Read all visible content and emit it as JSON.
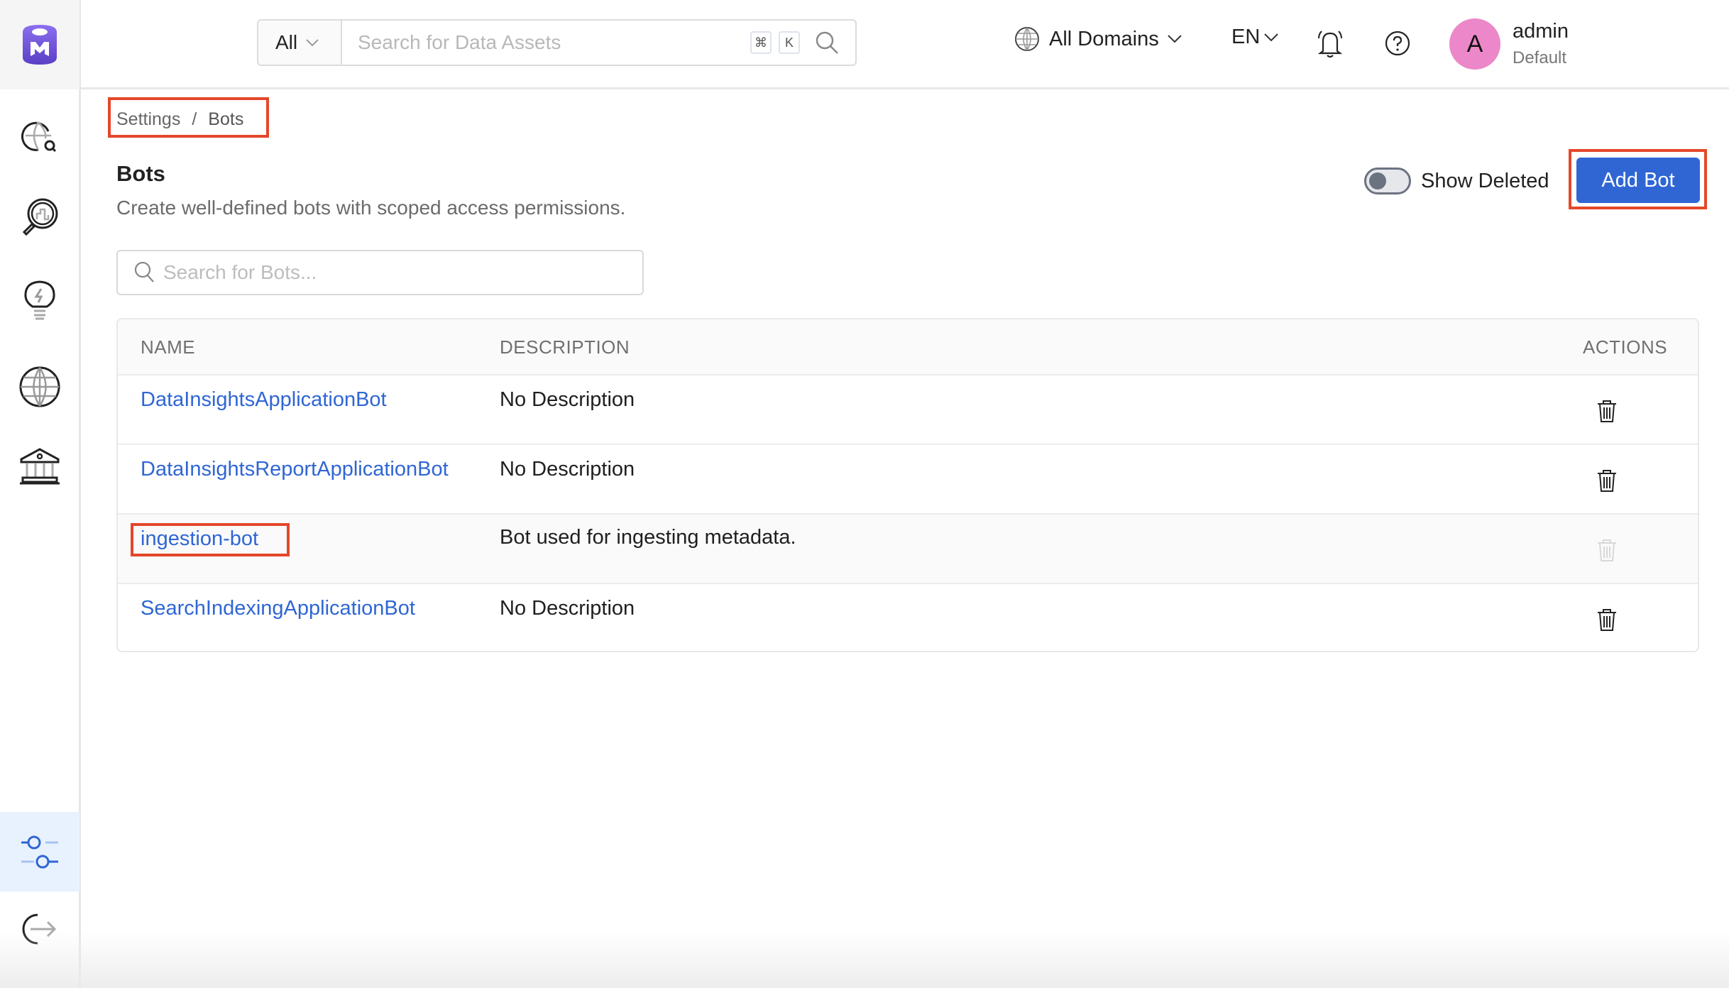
{
  "sidebar": {
    "logo": "openmetadata-logo-icon",
    "items": [
      {
        "name": "explore",
        "icon": "globe-search-icon"
      },
      {
        "name": "data-quality",
        "icon": "magnifier-chart-icon"
      },
      {
        "name": "insights",
        "icon": "lightbulb-icon"
      },
      {
        "name": "domains",
        "icon": "globe-icon"
      },
      {
        "name": "governance",
        "icon": "bank-building-icon"
      },
      {
        "name": "settings",
        "icon": "sliders-icon",
        "active": true
      },
      {
        "name": "logout",
        "icon": "logout-icon"
      }
    ],
    "active_color": "#2f66d4",
    "active_bg": "#e8f2fe"
  },
  "header": {
    "search": {
      "scope": "All",
      "placeholder": "Search for Data Assets",
      "value": "",
      "shortcut_keys": [
        "⌘",
        "K"
      ]
    },
    "domain_selector": "All Domains",
    "language": "EN",
    "user": {
      "initial": "A",
      "name": "admin",
      "role": "Default",
      "avatar_color": "#ec87c9"
    }
  },
  "breadcrumb": [
    {
      "label": "Settings"
    },
    {
      "label": "Bots"
    }
  ],
  "breadcrumb_separator": "/",
  "page": {
    "title": "Bots",
    "subtitle": "Create well-defined bots with scoped access permissions.",
    "show_deleted_label": "Show Deleted",
    "show_deleted": false,
    "add_button_label": "Add Bot",
    "bot_search_placeholder": "Search for Bots...",
    "bot_search_value": ""
  },
  "table": {
    "columns": [
      "NAME",
      "DESCRIPTION",
      "ACTIONS"
    ],
    "rows": [
      {
        "name": "DataInsightsApplicationBot",
        "description": "No Description",
        "delete_enabled": true
      },
      {
        "name": "DataInsightsReportApplicationBot",
        "description": "No Description",
        "delete_enabled": true
      },
      {
        "name": "ingestion-bot",
        "description": "Bot used for ingesting metadata.",
        "delete_enabled": false
      },
      {
        "name": "SearchIndexingApplicationBot",
        "description": "No Description",
        "delete_enabled": true
      }
    ]
  },
  "colors": {
    "primary": "#2f66d4",
    "highlight_box": "#e4472a"
  }
}
